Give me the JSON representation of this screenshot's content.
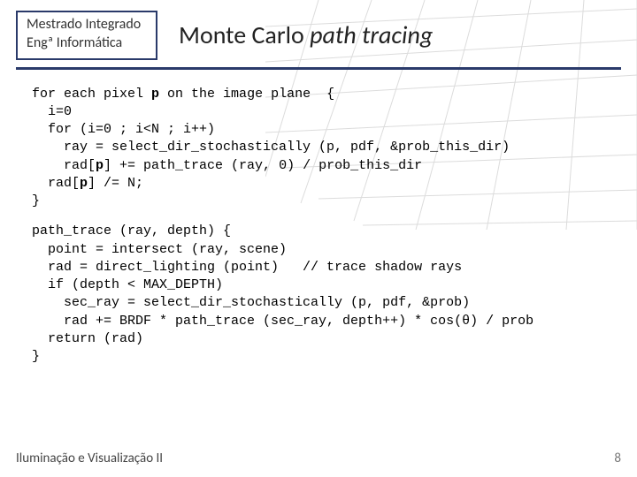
{
  "badge": {
    "line1": "Mestrado Integrado",
    "line2": "Engª  Informática"
  },
  "title": {
    "part1": "Monte Carlo ",
    "part2": "path tracing"
  },
  "code_block1": "for each pixel <b>p</b> on the image plane  {\n  i=0\n  for (i=0 ; i<N ; i++)\n    ray = select_dir_stochastically (p, pdf, &prob_this_dir)\n    rad[<b>p</b>] += path_trace (ray, 0) / prob_this_dir\n  rad[<b>p</b>] /= N;\n}",
  "code_block2": "path_trace (ray, depth) {\n  point = intersect (ray, scene)\n  rad = direct_lighting (point)   // trace shadow rays\n  if (depth < MAX_DEPTH)\n    sec_ray = select_dir_stochastically (p, pdf, &prob)\n    rad += BRDF * path_trace (sec_ray, depth++) * cos(θ) / prob\n  return (rad)\n}",
  "footer_text": "Iluminação e Visualização II",
  "page_number": "8"
}
